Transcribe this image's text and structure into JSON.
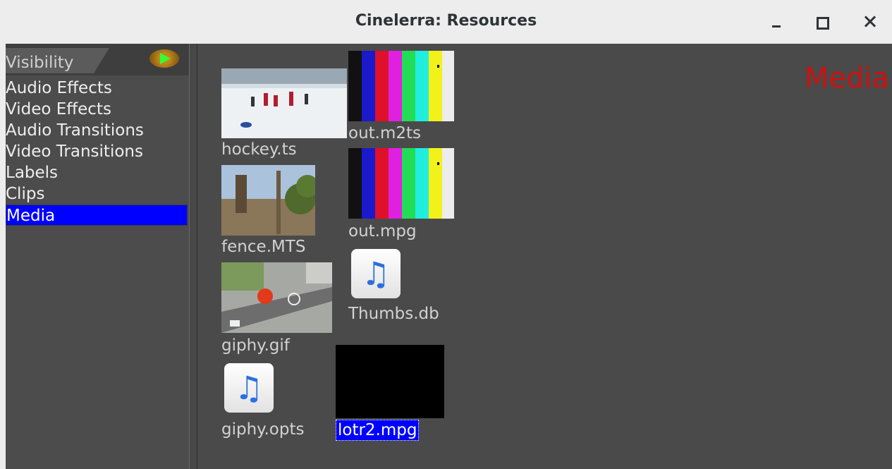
{
  "window": {
    "title": "Cinelerra: Resources"
  },
  "sidebar": {
    "visibility_label": "Visibility",
    "folders": [
      "Audio Effects",
      "Video Effects",
      "Audio Transitions",
      "Video Transitions",
      "Labels",
      "Clips",
      "Media"
    ],
    "selected_folder": "Media"
  },
  "main": {
    "heading": "Media",
    "assets": [
      "hockey.ts",
      "out.m2ts",
      "fence.MTS",
      "out.mpg",
      "giphy.gif",
      "Thumbs.db",
      "giphy.opts",
      "lotr2.mpg"
    ],
    "selected_asset": "lotr2.mpg"
  },
  "colors": {
    "selection": "#0000ff",
    "heading": "#cc1111",
    "background": "#4a4a4a"
  }
}
